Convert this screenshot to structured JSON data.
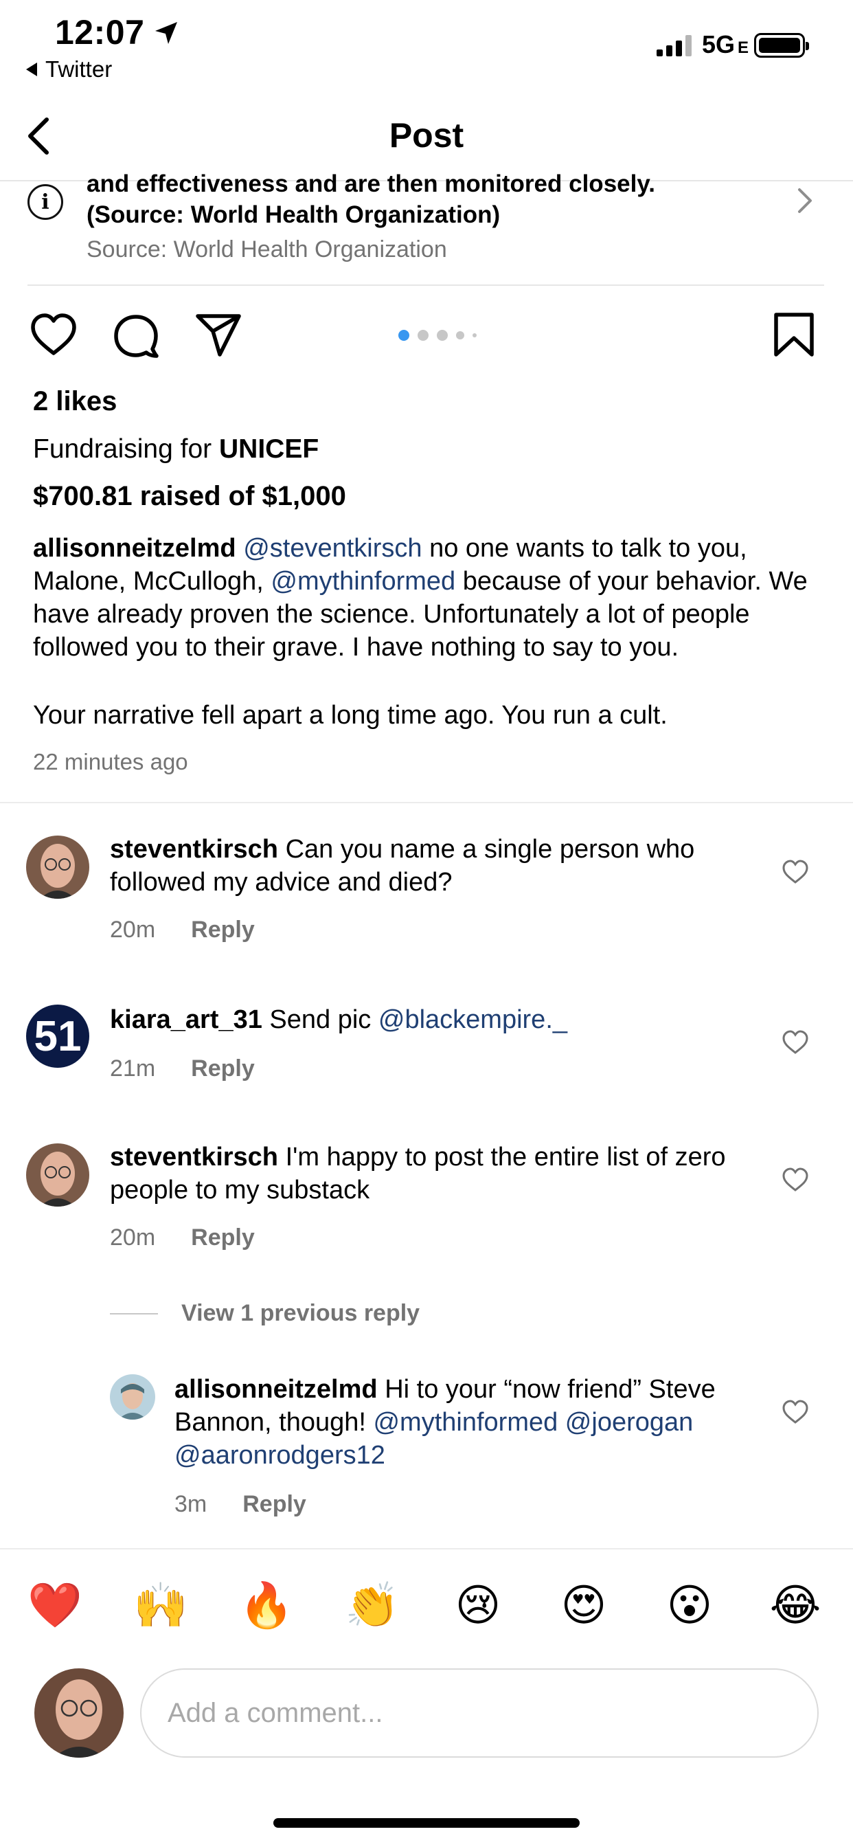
{
  "status_bar": {
    "time": "12:07",
    "back_app": "Twitter",
    "network": "5G",
    "network_suffix": "E"
  },
  "header": {
    "title": "Post"
  },
  "info_card": {
    "line1": "and effectiveness and are then monitored closely.",
    "line2": "(Source: World Health Organization)",
    "source": "Source: World Health Organization",
    "icon": "info-icon"
  },
  "post": {
    "likes": "2 likes",
    "fundraising_prefix": "Fundraising for",
    "fundraising_org": "UNICEF",
    "raised": "$700.81 raised of $1,000",
    "carousel_pages": 5,
    "carousel_active": 1,
    "caption": {
      "username": "allisonneitzelmd",
      "mention1": "@steventkirsch",
      "text1": "no one wants to talk to you, Malone, McCullogh,",
      "mention2": "@mythinformed",
      "text2": "because of your behavior. We have already proven the science. Unfortunately a lot of people followed you to their grave. I have nothing to say to you.",
      "text3": "Your narrative fell apart a long time ago. You run a cult."
    },
    "time_ago": "22 minutes ago"
  },
  "comments": [
    {
      "username": "steventkirsch",
      "text": "Can you name a single person who followed my advice and died?",
      "time": "20m",
      "reply_label": "Reply"
    },
    {
      "username": "kiara_art_31",
      "text": "Send pic",
      "mention": "@blackempire._",
      "avatar_text": "51",
      "time": "21m",
      "reply_label": "Reply"
    },
    {
      "username": "steventkirsch",
      "text": "I'm happy to post the entire list of zero people to my substack",
      "time": "20m",
      "reply_label": "Reply"
    }
  ],
  "view_previous": "View 1 previous reply",
  "reply": {
    "username": "allisonneitzelmd",
    "text": "Hi to your “now friend” Steve Bannon, though!",
    "mentions": "@mythinformed @joerogan @aaronrodgers12",
    "time": "3m",
    "reply_label": "Reply"
  },
  "emoji_bar": [
    "❤️",
    "🙌",
    "🔥",
    "👏",
    "😢",
    "😍",
    "😮",
    "😂"
  ],
  "composer": {
    "placeholder": "Add a comment..."
  },
  "colors": {
    "mention": "#1f3f73",
    "muted": "#737373",
    "carousel_active": "#3897f0"
  }
}
